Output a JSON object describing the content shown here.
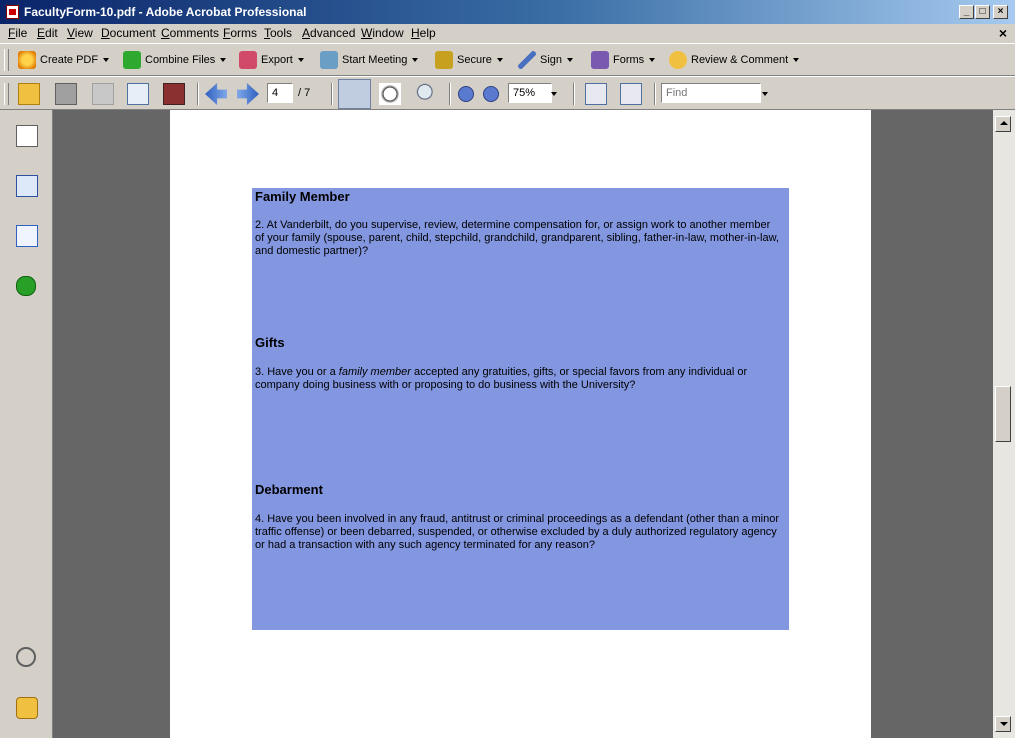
{
  "window": {
    "title": "FacultyForm-10.pdf - Adobe Acrobat Professional"
  },
  "menu": [
    {
      "u": "F",
      "rest": "ile"
    },
    {
      "u": "E",
      "rest": "dit"
    },
    {
      "u": "V",
      "rest": "iew"
    },
    {
      "u": "D",
      "rest": "ocument"
    },
    {
      "u": "C",
      "rest": "omments"
    },
    {
      "u": "F",
      "rest": "orms"
    },
    {
      "u": "T",
      "rest": "ools"
    },
    {
      "u": "A",
      "rest": "dvanced"
    },
    {
      "u": "W",
      "rest": "indow"
    },
    {
      "u": "H",
      "rest": "elp"
    }
  ],
  "toolbar1": {
    "create_pdf": "Create PDF",
    "combine_files": "Combine Files",
    "export": "Export",
    "start_meeting": "Start Meeting",
    "secure": "Secure",
    "sign": "Sign",
    "forms": "Forms",
    "review_comment": "Review & Comment"
  },
  "toolbar2": {
    "page_current": "4",
    "page_total": "/ 7",
    "zoom": "75%",
    "find_placeholder": "Find"
  },
  "document": {
    "sections": [
      {
        "title": "Family Member",
        "text_parts": [
          "2.  At Vanderbilt, do you supervise, review, determine compensation for, or assign work to another member of your family (spouse, parent, child, stepchild, grandchild, grandparent, sibling, father-in-law, mother-in-law, and domestic partner)?"
        ]
      },
      {
        "title": "Gifts",
        "text_pre": "3.  Have you or a ",
        "text_em": "family member",
        "text_post": " accepted any gratuities, gifts, or special favors from any individual or company doing business with or proposing to do business with the University?"
      },
      {
        "title": "Debarment",
        "text_parts": [
          "4.  Have you been involved in any fraud, antitrust or criminal proceedings as a defendant (other than a minor traffic offense) or been debarred, suspended, or otherwise excluded by a duly authorized regulatory agency or had a transaction with any such agency terminated for any reason?"
        ]
      }
    ]
  }
}
